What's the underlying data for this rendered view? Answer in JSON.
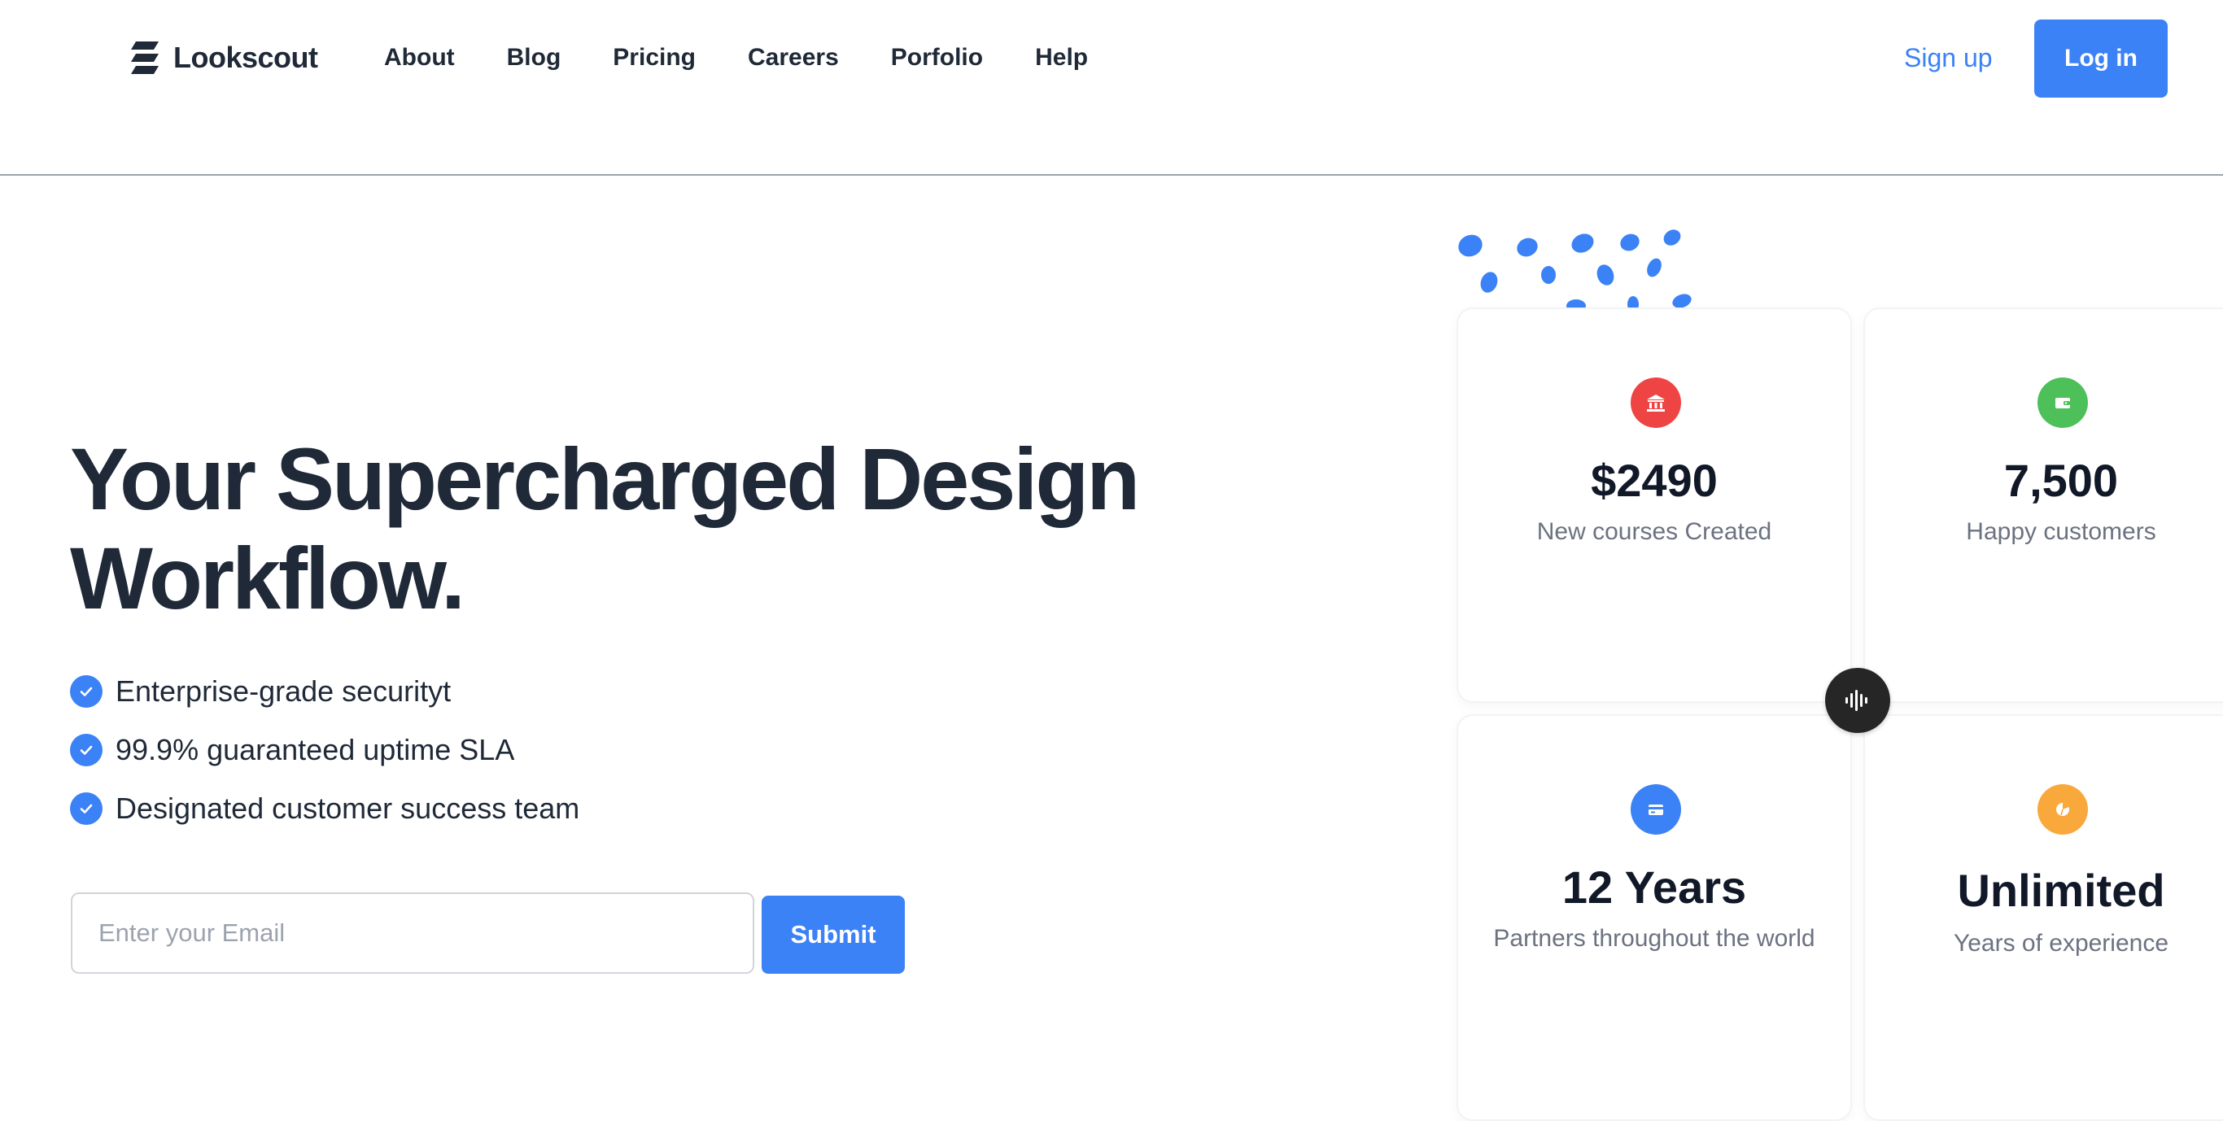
{
  "header": {
    "brand": "Lookscout",
    "nav": [
      "About",
      "Blog",
      "Pricing",
      "Careers",
      "Porfolio",
      "Help"
    ],
    "signup_label": "Sign up",
    "login_label": "Log in"
  },
  "hero": {
    "title": "Your Supercharged Design Workflow.",
    "features": [
      "Enterprise-grade securityt",
      "99.9% guaranteed uptime SLA",
      "Designated customer success team"
    ],
    "email_placeholder": "Enter your Email",
    "email_value": "",
    "submit_label": "Submit"
  },
  "stats": [
    {
      "value": "$2490",
      "label": "New courses Created",
      "icon": "bank-icon",
      "color": "#ef4444"
    },
    {
      "value": "7,500",
      "label": "Happy customers",
      "icon": "wallet-icon",
      "color": "#4ec05a"
    },
    {
      "value": "12 Years",
      "label": "Partners throughout the world",
      "icon": "credit-card-icon",
      "color": "#3b82f6"
    },
    {
      "value": "Unlimited",
      "label": "Years of experience",
      "icon": "pie-chart-icon",
      "color": "#f9a83b"
    }
  ],
  "colors": {
    "accent": "#3b82f6",
    "text": "#1f2937",
    "muted": "#6b7280",
    "badge": "#262626"
  },
  "icons": {
    "brand": "lookscout-logo-icon",
    "feature_bullet": "check-circle-icon",
    "center_badge": "audio-wave-icon"
  }
}
